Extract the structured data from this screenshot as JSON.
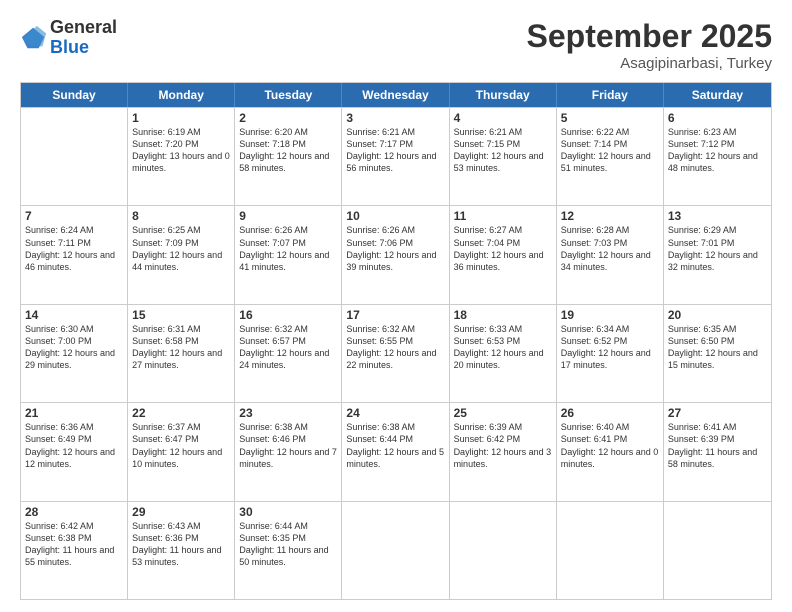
{
  "logo": {
    "general": "General",
    "blue": "Blue"
  },
  "header": {
    "month": "September 2025",
    "location": "Asagipinarbasi, Turkey"
  },
  "days": [
    "Sunday",
    "Monday",
    "Tuesday",
    "Wednesday",
    "Thursday",
    "Friday",
    "Saturday"
  ],
  "weeks": [
    [
      {
        "day": "",
        "empty": true
      },
      {
        "day": "1",
        "sunrise": "Sunrise: 6:19 AM",
        "sunset": "Sunset: 7:20 PM",
        "daylight": "Daylight: 13 hours and 0 minutes."
      },
      {
        "day": "2",
        "sunrise": "Sunrise: 6:20 AM",
        "sunset": "Sunset: 7:18 PM",
        "daylight": "Daylight: 12 hours and 58 minutes."
      },
      {
        "day": "3",
        "sunrise": "Sunrise: 6:21 AM",
        "sunset": "Sunset: 7:17 PM",
        "daylight": "Daylight: 12 hours and 56 minutes."
      },
      {
        "day": "4",
        "sunrise": "Sunrise: 6:21 AM",
        "sunset": "Sunset: 7:15 PM",
        "daylight": "Daylight: 12 hours and 53 minutes."
      },
      {
        "day": "5",
        "sunrise": "Sunrise: 6:22 AM",
        "sunset": "Sunset: 7:14 PM",
        "daylight": "Daylight: 12 hours and 51 minutes."
      },
      {
        "day": "6",
        "sunrise": "Sunrise: 6:23 AM",
        "sunset": "Sunset: 7:12 PM",
        "daylight": "Daylight: 12 hours and 48 minutes."
      }
    ],
    [
      {
        "day": "7",
        "sunrise": "Sunrise: 6:24 AM",
        "sunset": "Sunset: 7:11 PM",
        "daylight": "Daylight: 12 hours and 46 minutes."
      },
      {
        "day": "8",
        "sunrise": "Sunrise: 6:25 AM",
        "sunset": "Sunset: 7:09 PM",
        "daylight": "Daylight: 12 hours and 44 minutes."
      },
      {
        "day": "9",
        "sunrise": "Sunrise: 6:26 AM",
        "sunset": "Sunset: 7:07 PM",
        "daylight": "Daylight: 12 hours and 41 minutes."
      },
      {
        "day": "10",
        "sunrise": "Sunrise: 6:26 AM",
        "sunset": "Sunset: 7:06 PM",
        "daylight": "Daylight: 12 hours and 39 minutes."
      },
      {
        "day": "11",
        "sunrise": "Sunrise: 6:27 AM",
        "sunset": "Sunset: 7:04 PM",
        "daylight": "Daylight: 12 hours and 36 minutes."
      },
      {
        "day": "12",
        "sunrise": "Sunrise: 6:28 AM",
        "sunset": "Sunset: 7:03 PM",
        "daylight": "Daylight: 12 hours and 34 minutes."
      },
      {
        "day": "13",
        "sunrise": "Sunrise: 6:29 AM",
        "sunset": "Sunset: 7:01 PM",
        "daylight": "Daylight: 12 hours and 32 minutes."
      }
    ],
    [
      {
        "day": "14",
        "sunrise": "Sunrise: 6:30 AM",
        "sunset": "Sunset: 7:00 PM",
        "daylight": "Daylight: 12 hours and 29 minutes."
      },
      {
        "day": "15",
        "sunrise": "Sunrise: 6:31 AM",
        "sunset": "Sunset: 6:58 PM",
        "daylight": "Daylight: 12 hours and 27 minutes."
      },
      {
        "day": "16",
        "sunrise": "Sunrise: 6:32 AM",
        "sunset": "Sunset: 6:57 PM",
        "daylight": "Daylight: 12 hours and 24 minutes."
      },
      {
        "day": "17",
        "sunrise": "Sunrise: 6:32 AM",
        "sunset": "Sunset: 6:55 PM",
        "daylight": "Daylight: 12 hours and 22 minutes."
      },
      {
        "day": "18",
        "sunrise": "Sunrise: 6:33 AM",
        "sunset": "Sunset: 6:53 PM",
        "daylight": "Daylight: 12 hours and 20 minutes."
      },
      {
        "day": "19",
        "sunrise": "Sunrise: 6:34 AM",
        "sunset": "Sunset: 6:52 PM",
        "daylight": "Daylight: 12 hours and 17 minutes."
      },
      {
        "day": "20",
        "sunrise": "Sunrise: 6:35 AM",
        "sunset": "Sunset: 6:50 PM",
        "daylight": "Daylight: 12 hours and 15 minutes."
      }
    ],
    [
      {
        "day": "21",
        "sunrise": "Sunrise: 6:36 AM",
        "sunset": "Sunset: 6:49 PM",
        "daylight": "Daylight: 12 hours and 12 minutes."
      },
      {
        "day": "22",
        "sunrise": "Sunrise: 6:37 AM",
        "sunset": "Sunset: 6:47 PM",
        "daylight": "Daylight: 12 hours and 10 minutes."
      },
      {
        "day": "23",
        "sunrise": "Sunrise: 6:38 AM",
        "sunset": "Sunset: 6:46 PM",
        "daylight": "Daylight: 12 hours and 7 minutes."
      },
      {
        "day": "24",
        "sunrise": "Sunrise: 6:38 AM",
        "sunset": "Sunset: 6:44 PM",
        "daylight": "Daylight: 12 hours and 5 minutes."
      },
      {
        "day": "25",
        "sunrise": "Sunrise: 6:39 AM",
        "sunset": "Sunset: 6:42 PM",
        "daylight": "Daylight: 12 hours and 3 minutes."
      },
      {
        "day": "26",
        "sunrise": "Sunrise: 6:40 AM",
        "sunset": "Sunset: 6:41 PM",
        "daylight": "Daylight: 12 hours and 0 minutes."
      },
      {
        "day": "27",
        "sunrise": "Sunrise: 6:41 AM",
        "sunset": "Sunset: 6:39 PM",
        "daylight": "Daylight: 11 hours and 58 minutes."
      }
    ],
    [
      {
        "day": "28",
        "sunrise": "Sunrise: 6:42 AM",
        "sunset": "Sunset: 6:38 PM",
        "daylight": "Daylight: 11 hours and 55 minutes."
      },
      {
        "day": "29",
        "sunrise": "Sunrise: 6:43 AM",
        "sunset": "Sunset: 6:36 PM",
        "daylight": "Daylight: 11 hours and 53 minutes."
      },
      {
        "day": "30",
        "sunrise": "Sunrise: 6:44 AM",
        "sunset": "Sunset: 6:35 PM",
        "daylight": "Daylight: 11 hours and 50 minutes."
      },
      {
        "day": "",
        "empty": true
      },
      {
        "day": "",
        "empty": true
      },
      {
        "day": "",
        "empty": true
      },
      {
        "day": "",
        "empty": true
      }
    ]
  ]
}
